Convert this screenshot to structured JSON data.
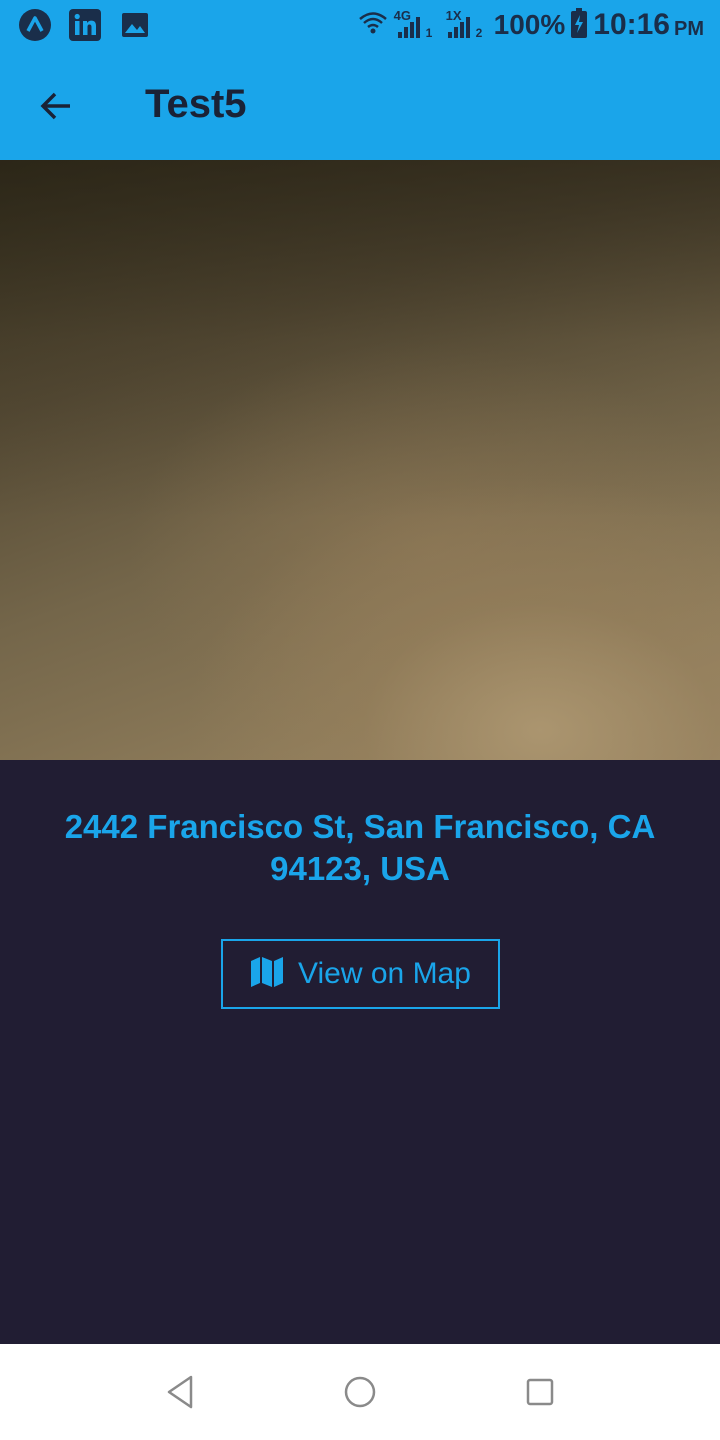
{
  "status_bar": {
    "left_icons": [
      "a-logo-icon",
      "linkedin-icon",
      "image-icon"
    ],
    "network_4g": "4G",
    "network_1x": "1X",
    "sim1": "1",
    "sim2": "2",
    "battery": "100%",
    "time": "10:16",
    "ampm": "PM"
  },
  "app_bar": {
    "title": "Test5"
  },
  "location": {
    "address": "2442 Francisco St, San Francisco, CA 94123, USA"
  },
  "map_button": {
    "label": "View on Map"
  },
  "colors": {
    "accent": "#1aa5ea",
    "background": "#211d33",
    "app_bar_text": "#1a2236"
  }
}
